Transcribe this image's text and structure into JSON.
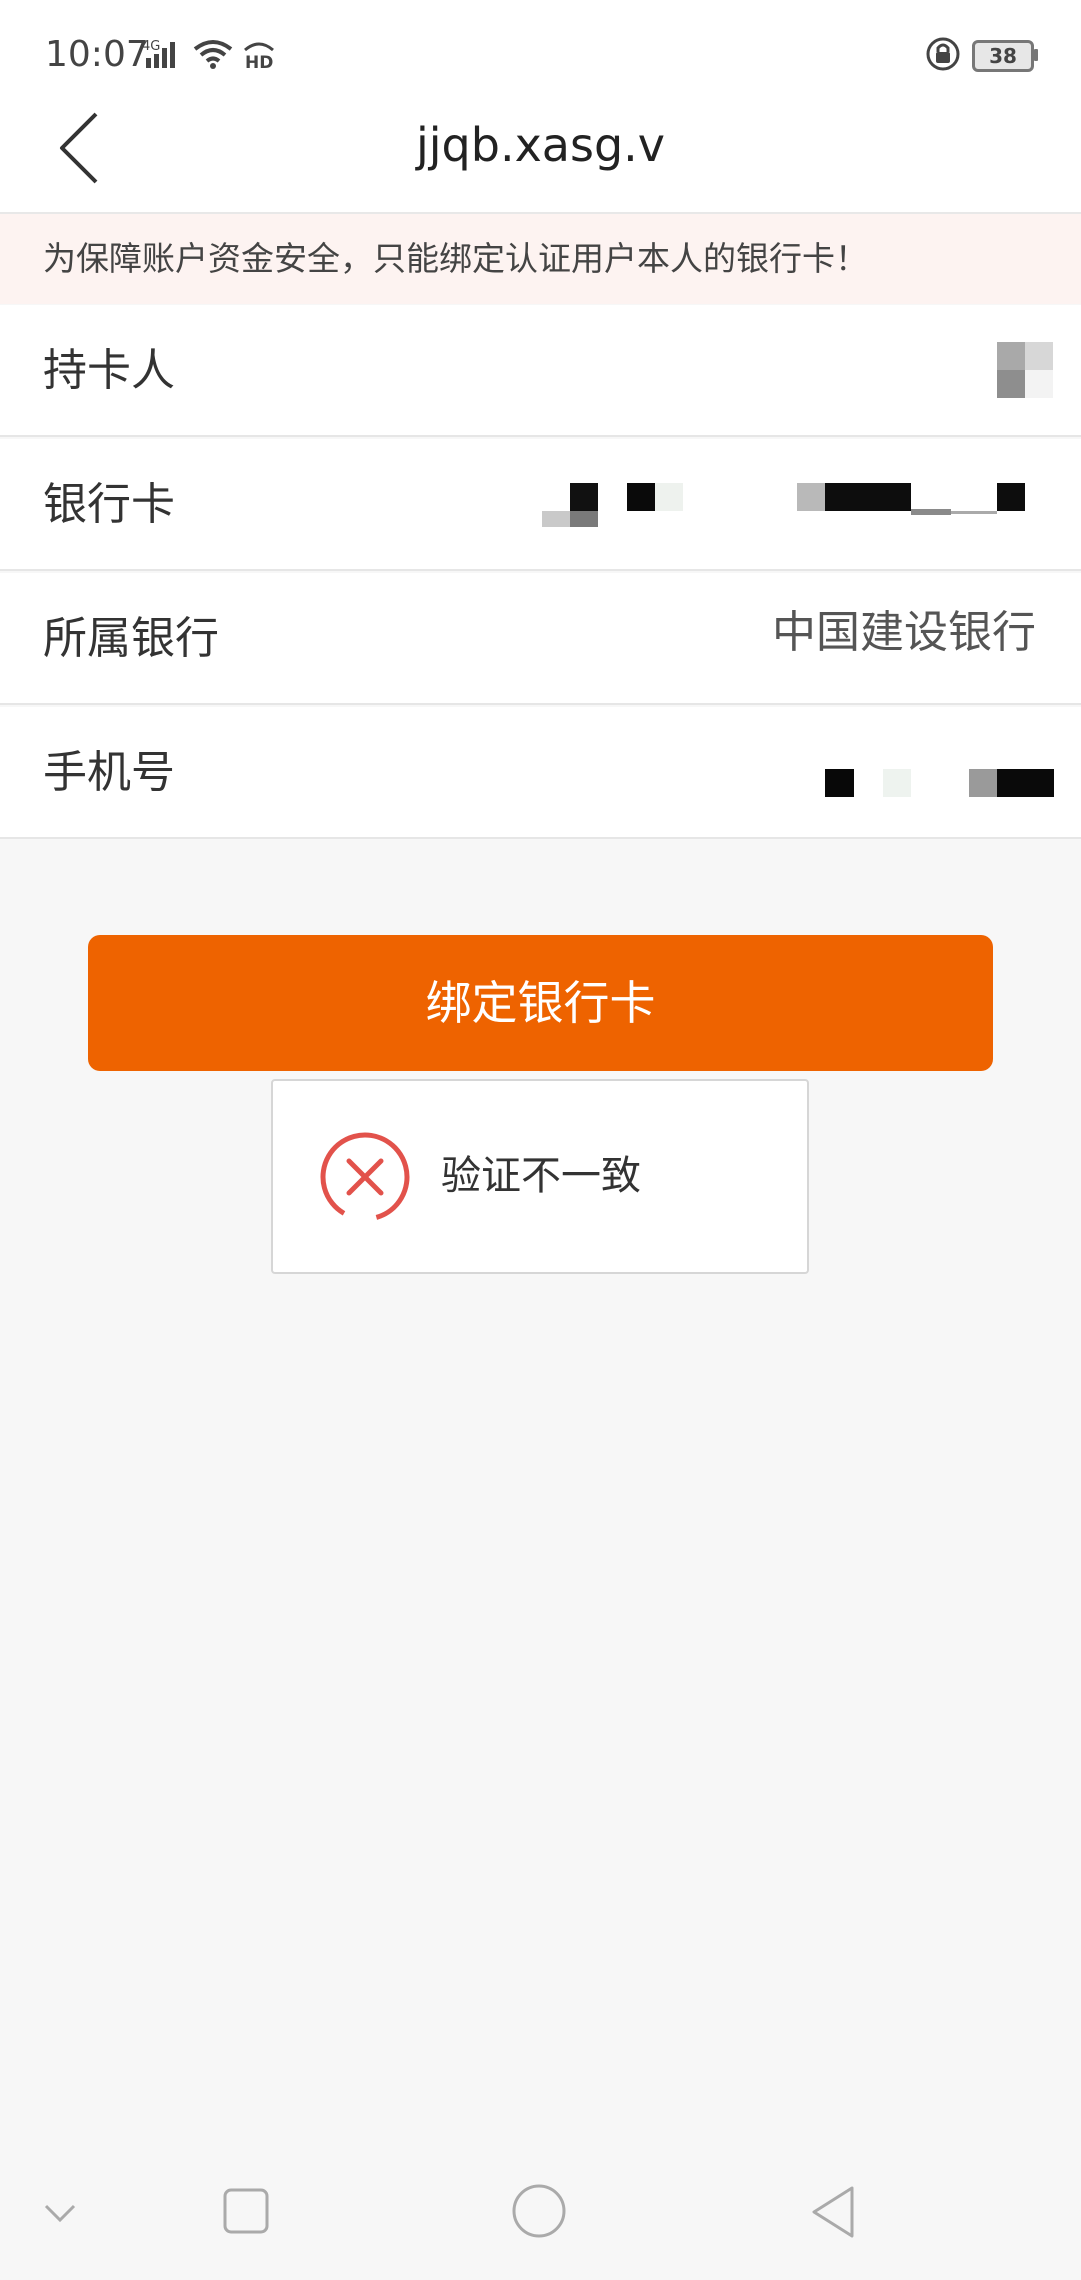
{
  "status_bar": {
    "time": "10:07",
    "battery": "38",
    "network": "4G",
    "wifi_badge": "HD"
  },
  "header": {
    "title": "jjqb.xasg.v"
  },
  "notice": {
    "text": "为保障账户资金安全，只能绑定认证用户本人的银行卡！"
  },
  "form": {
    "cardholder_label": "持卡人",
    "bank_card_label": "银行卡",
    "bank_label": "所属银行",
    "bank_value": "中国建设银行",
    "phone_label": "手机号"
  },
  "bind_button_label": "绑定银行卡",
  "toast": {
    "text": "验证不一致"
  },
  "colors": {
    "accent": "#ee6300",
    "error": "#e2524b",
    "notice_bg": "#fdf3f1"
  }
}
